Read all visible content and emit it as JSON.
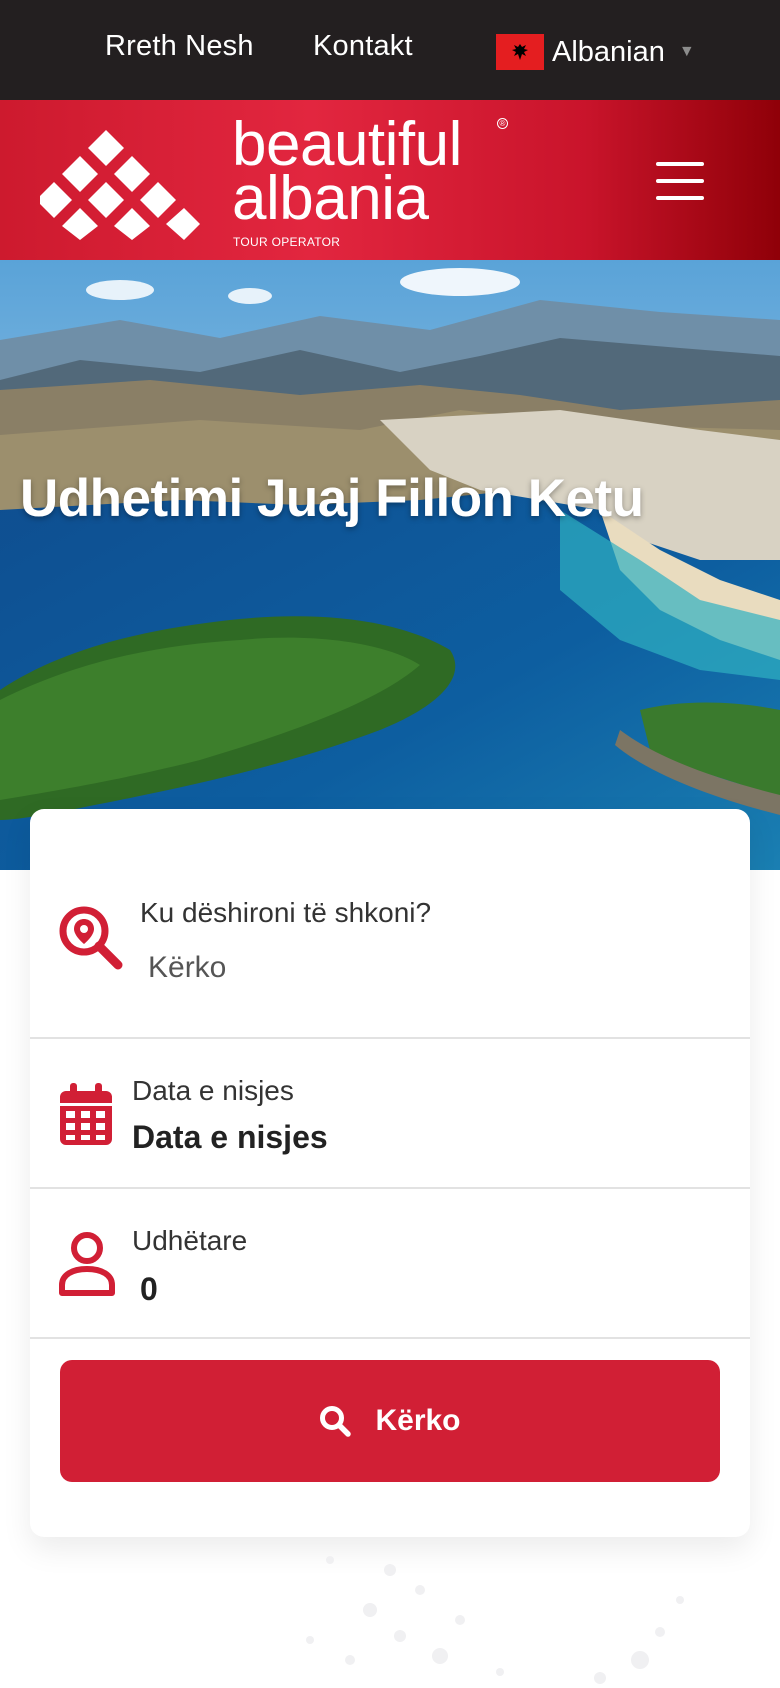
{
  "topbar": {
    "about_label": "Rreth Nesh",
    "contact_label": "Kontakt",
    "language_label": "Albanian",
    "language_flag": "albania-flag-icon"
  },
  "brand": {
    "name_line1": "beautiful",
    "name_line2": "albania",
    "registered": "®",
    "subtitle": "TOUR OPERATOR",
    "menu_icon": "hamburger-menu-icon"
  },
  "hero": {
    "title": "Udhetimi Juaj Fillon Ketu"
  },
  "search": {
    "destination": {
      "label": "Ku dëshironi të shkoni?",
      "placeholder": "Kërko",
      "value": "",
      "icon": "location-search-icon"
    },
    "date": {
      "label": "Data e nisjes",
      "value": "Data e nisjes",
      "icon": "calendar-icon"
    },
    "travelers": {
      "label": "Udhëtare",
      "value": "0",
      "icon": "user-icon"
    },
    "button_label": "Kërko",
    "button_icon": "search-icon"
  },
  "colors": {
    "accent": "#d11f35",
    "topbar": "#231f20",
    "brand_gradient_start": "#cd1a2e",
    "brand_gradient_end": "#8f0008"
  }
}
